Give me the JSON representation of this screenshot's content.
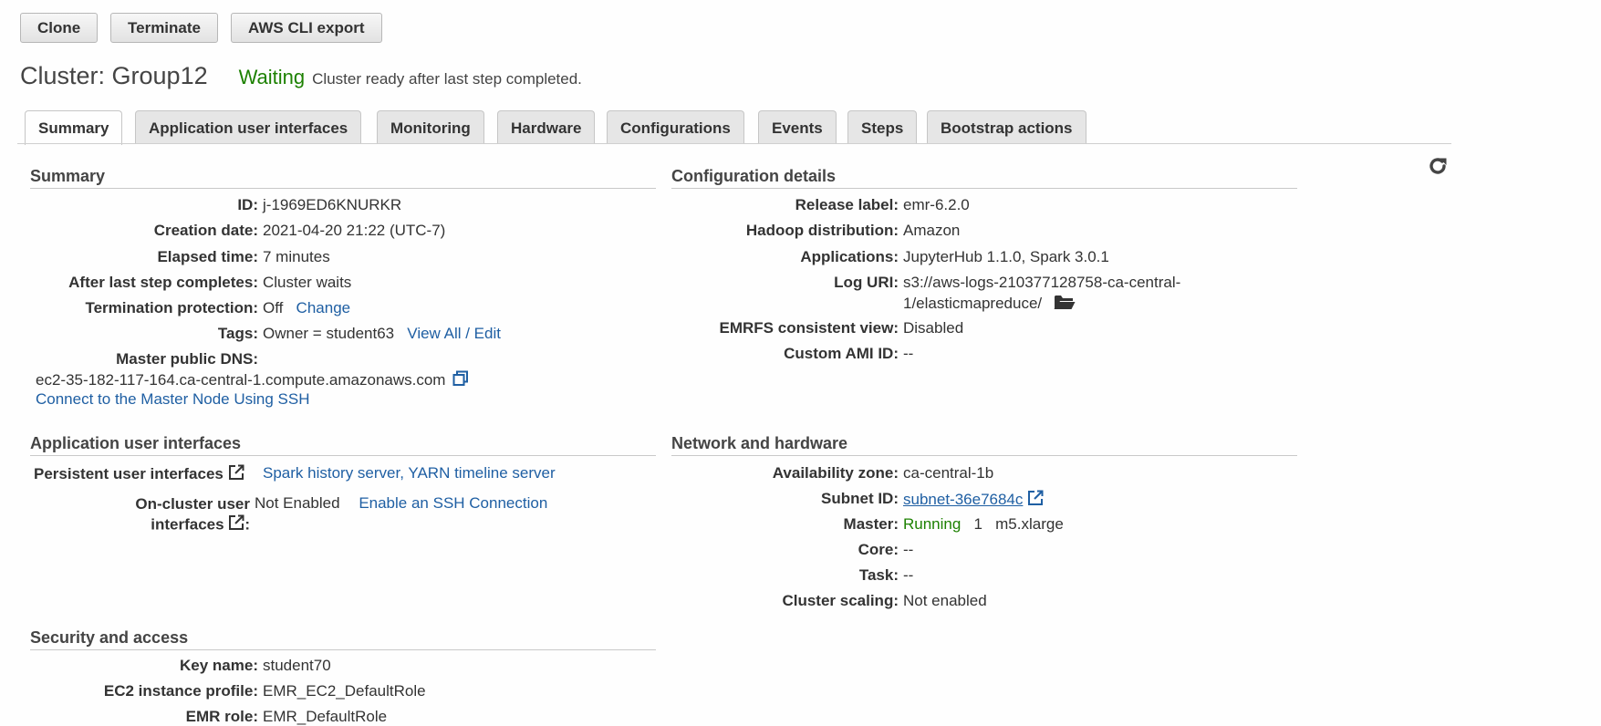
{
  "toolbar": {
    "clone": "Clone",
    "terminate": "Terminate",
    "cli_export": "AWS CLI export"
  },
  "cluster": {
    "title": "Cluster: Group12",
    "state": "Waiting",
    "message": "Cluster ready after last step completed."
  },
  "tabs": [
    "Summary",
    "Application user interfaces",
    "Monitoring",
    "Hardware",
    "Configurations",
    "Events",
    "Steps",
    "Bootstrap actions"
  ],
  "summary": {
    "title": "Summary",
    "id_label": "ID:",
    "id": "j-1969ED6KNURKR",
    "creation_label": "Creation date:",
    "creation": "2021-04-20 21:22 (UTC-7)",
    "elapsed_label": "Elapsed time:",
    "elapsed": "7 minutes",
    "after_label": "After last step completes:",
    "after": "Cluster waits",
    "termprot_label": "Termination protection:",
    "termprot": "Off",
    "termprot_link": "Change",
    "tags_label": "Tags:",
    "tags": "Owner = student63",
    "tags_link": "View All / Edit",
    "dns_label": "Master public DNS:",
    "dns": "ec2-35-182-117-164.ca-central-1.compute.amazonaws.com",
    "ssh_link": "Connect to the Master Node Using SSH"
  },
  "config": {
    "title": "Configuration details",
    "release_label": "Release label:",
    "release": "emr-6.2.0",
    "hadoop_label": "Hadoop distribution:",
    "hadoop": "Amazon",
    "apps_label": "Applications:",
    "apps": "JupyterHub 1.1.0, Spark 3.0.1",
    "log_label": "Log URI:",
    "log_line1": "s3://aws-logs-210377128758-ca-central-",
    "log_line2": "1/elasticmapreduce/",
    "emrfs_label": "EMRFS consistent view:",
    "emrfs": "Disabled",
    "ami_label": "Custom AMI ID:",
    "ami": "--"
  },
  "appui": {
    "title": "Application user interfaces",
    "persistent_label": "Persistent user interfaces",
    "spark_link": "Spark history server",
    "sep": ",",
    "yarn_link": "YARN timeline server",
    "oncluster_label_1": "On-cluster user",
    "oncluster_label_2": "interfaces",
    "colon": ":",
    "oncluster_value": "Not Enabled",
    "ssh_enable_link": "Enable an SSH Connection"
  },
  "network": {
    "title": "Network and hardware",
    "az_label": "Availability zone:",
    "az": "ca-central-1b",
    "subnet_label": "Subnet ID:",
    "subnet": "subnet-36e7684c",
    "master_label": "Master:",
    "master_status": "Running",
    "master_count": "1",
    "master_type": "m5.xlarge",
    "core_label": "Core:",
    "core": "--",
    "task_label": "Task:",
    "task": "--",
    "scaling_label": "Cluster scaling:",
    "scaling": "Not enabled"
  },
  "security": {
    "title": "Security and access",
    "key_label": "Key name:",
    "key": "student70",
    "profile_label": "EC2 instance profile:",
    "profile": "EMR_EC2_DefaultRole",
    "emrrole_label": "EMR role:",
    "emrrole": "EMR_DefaultRole"
  },
  "colors": {
    "accent": "#1f5fa3",
    "success": "#1d8102"
  },
  "icons": [
    "refresh-icon",
    "copy-icon",
    "folder-icon",
    "external-link-icon"
  ]
}
